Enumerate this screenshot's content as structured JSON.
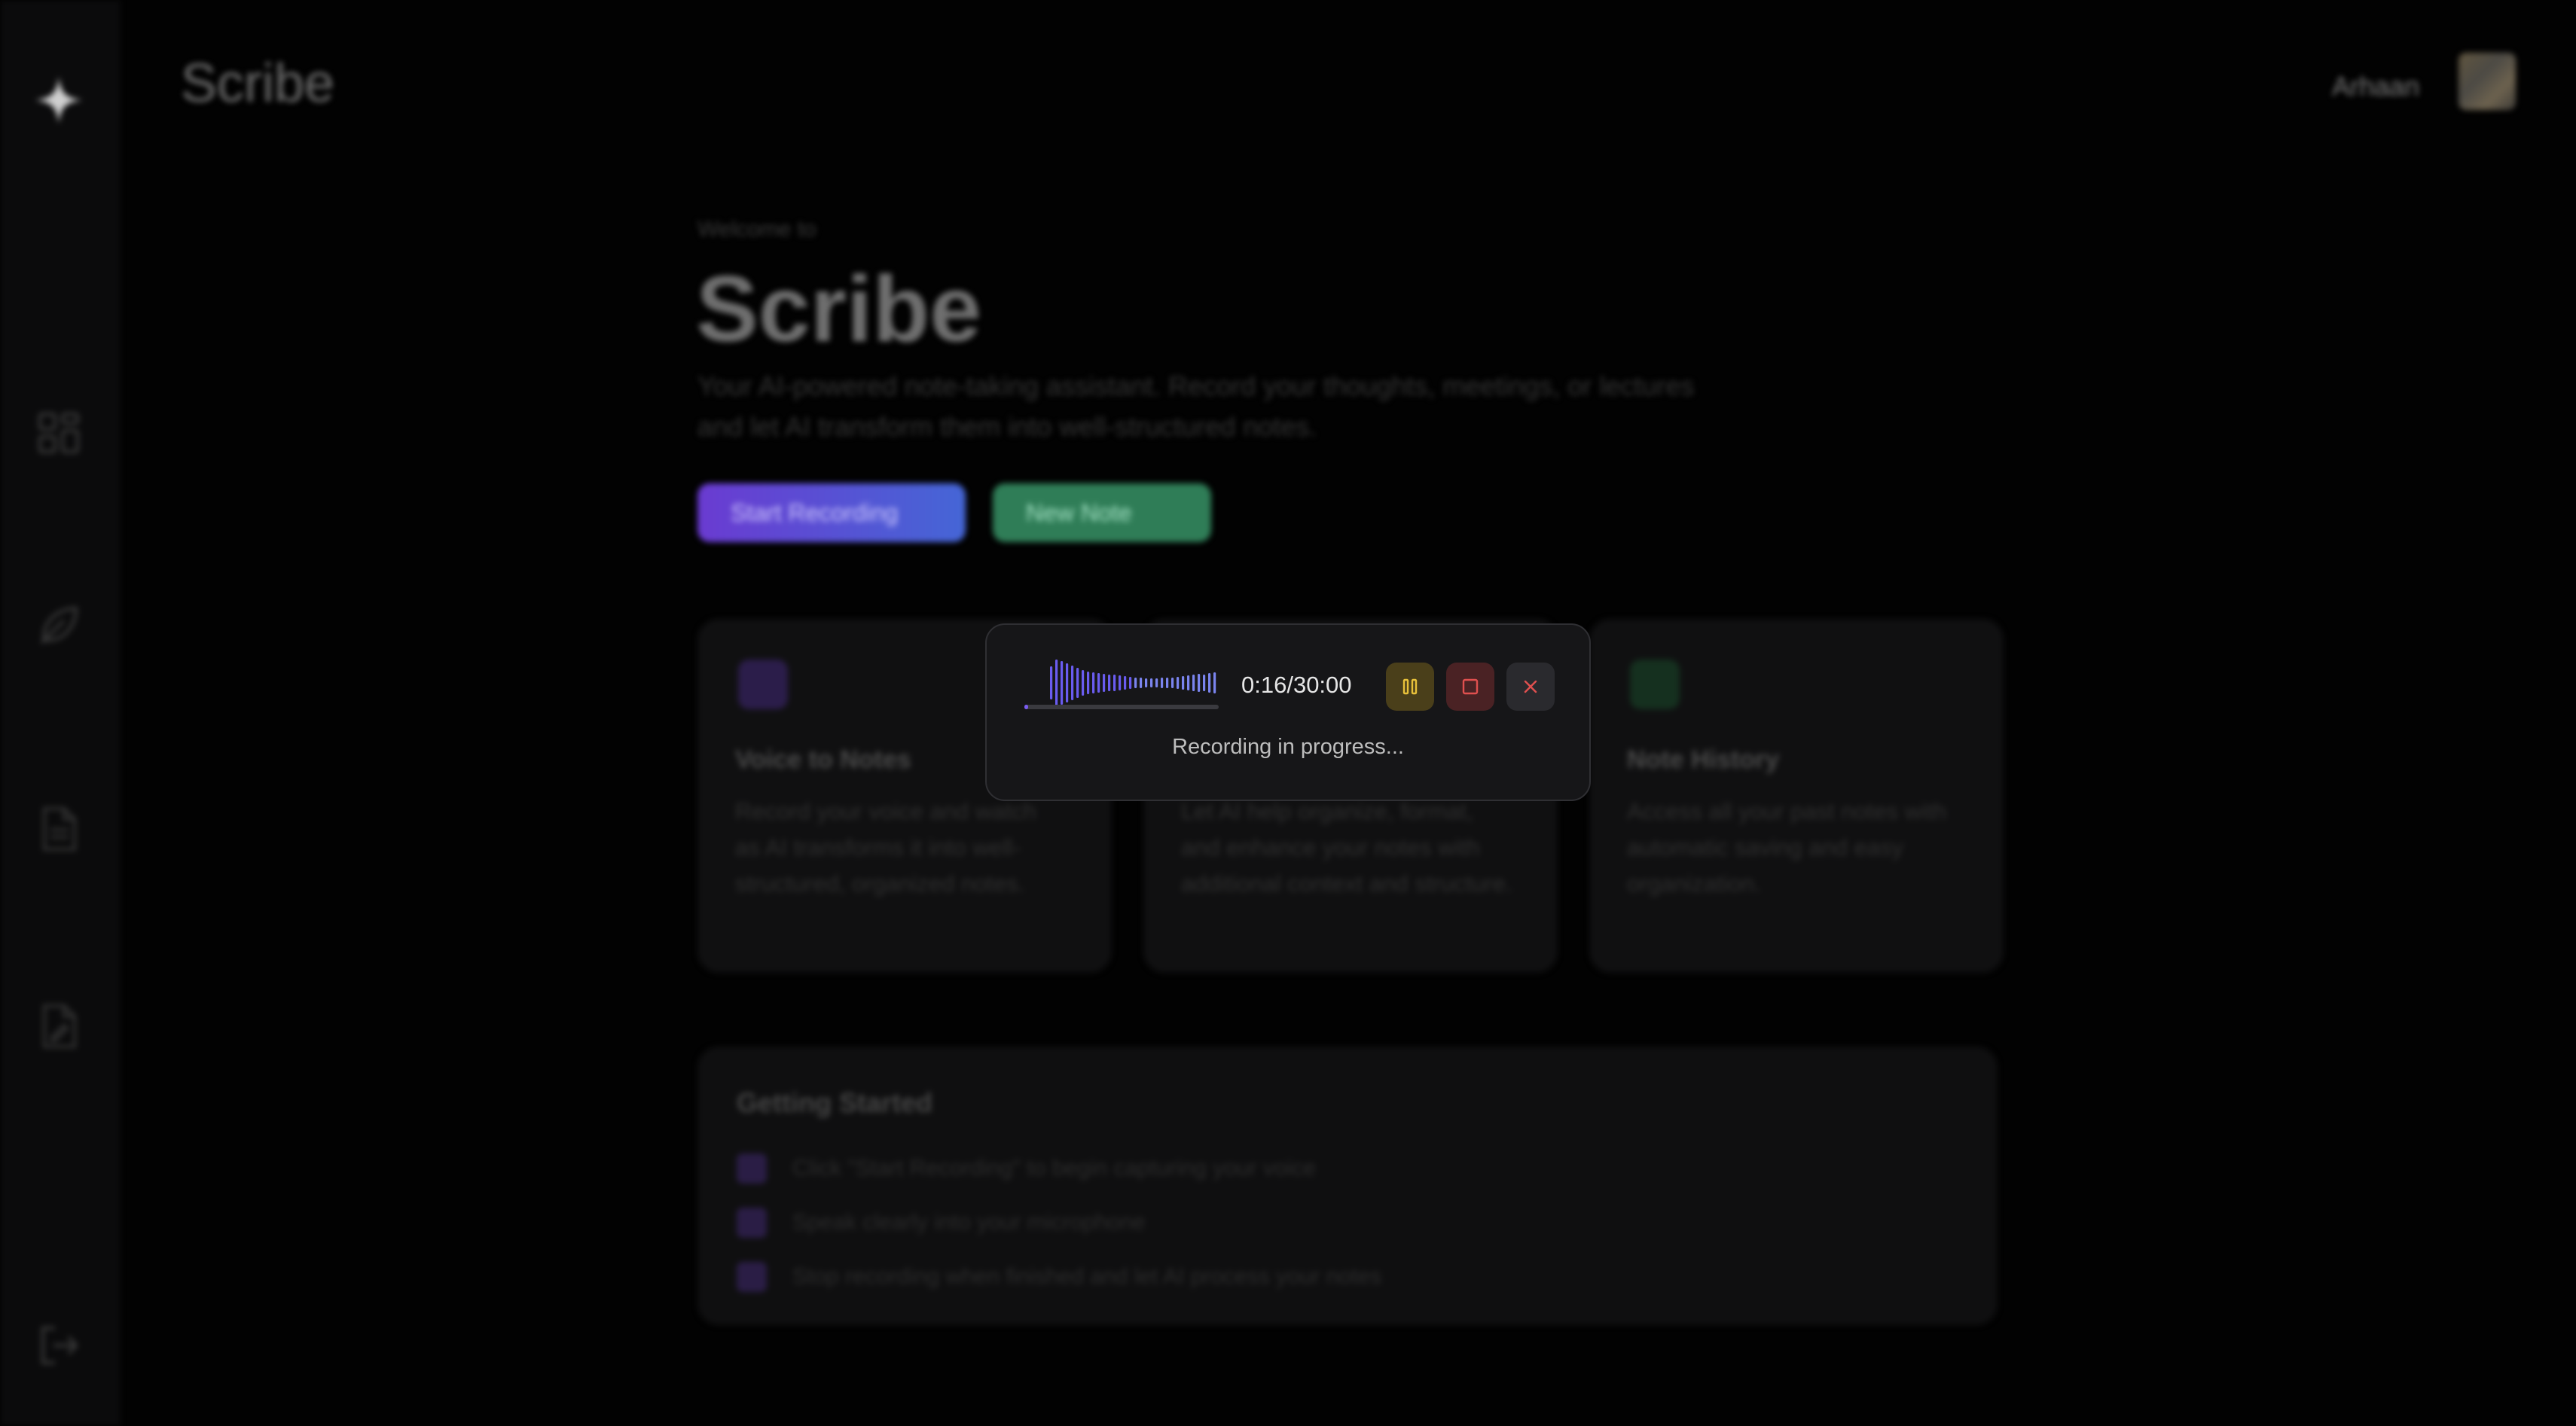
{
  "app": {
    "title": "Scribe",
    "user_name": "Arhaan"
  },
  "sidebar": {
    "items": [
      {
        "icon": "sparkle-logo-icon"
      },
      {
        "icon": "dashboard-icon"
      },
      {
        "icon": "feather-icon"
      },
      {
        "icon": "document-icon"
      },
      {
        "icon": "document-edit-icon"
      },
      {
        "icon": "logout-icon"
      }
    ]
  },
  "hero": {
    "welcome": "Welcome to",
    "title": "Scribe",
    "description_line1": "Your AI-powered note-taking assistant. Record your thoughts, meetings, or lectures",
    "description_line2": "and let AI transform them into well-structured notes.",
    "start_recording_label": "Start Recording",
    "new_note_label": "New Note"
  },
  "features": [
    {
      "title": "Voice to Notes",
      "description": "Record your voice and watch as AI transforms it into well-structured, organized notes.",
      "color": "#5b3aa8"
    },
    {
      "title": "",
      "description": "Let AI help organize, format, and enhance your notes with additional context and structure.",
      "color": "#3a3a6a"
    },
    {
      "title": "Note History",
      "description": "Access all your past notes with automatic saving and easy organization.",
      "color": "#2a6a4a"
    }
  ],
  "getting_started": {
    "title": "Getting Started",
    "steps": [
      "Click \"Start Recording\" to begin capturing your voice",
      "Speak clearly into your microphone",
      "Stop recording when finished and let AI process your notes"
    ]
  },
  "recorder": {
    "timer": "0:16/30:00",
    "status": "Recording in progress...",
    "progress": 0.009,
    "accent": "#7a5cf0",
    "pause_color": "#e8c13a",
    "stop_color": "#e0504f",
    "close_color": "#e0504f"
  }
}
